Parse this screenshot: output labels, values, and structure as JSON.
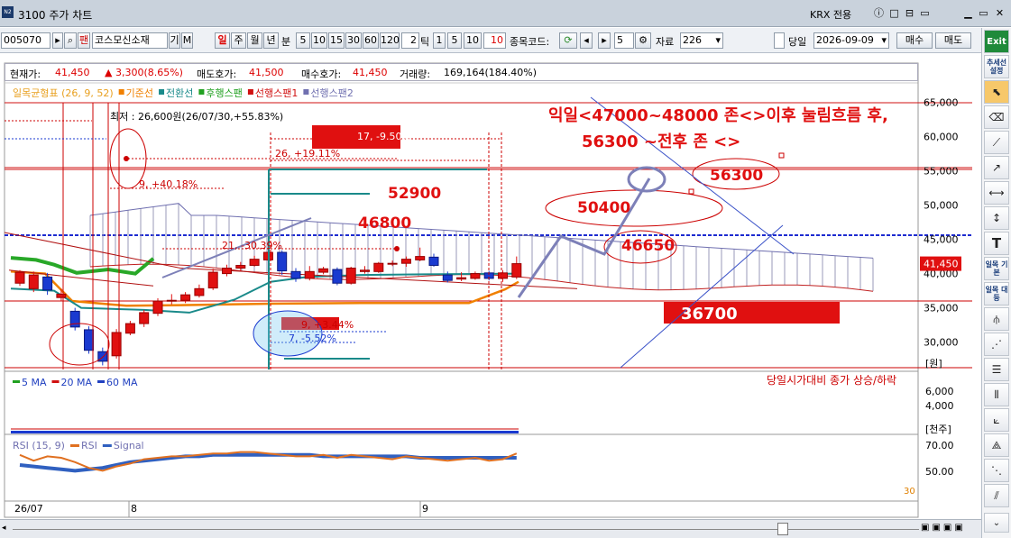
{
  "window": {
    "code_badge": "N2",
    "title": "3100 주가 차트",
    "exchange": "KRX 전용",
    "buttons": [
      "ⓘ",
      "□",
      "⊟",
      "▭",
      "⊠",
      "▭",
      "✕"
    ]
  },
  "toolbar": {
    "stock_code": "005070",
    "stock_name": "코스모신소재",
    "btn_gi": "기",
    "btn_m": "M",
    "period_tabs": [
      "일",
      "주",
      "월",
      "년"
    ],
    "minute_label": "분",
    "minute_options": [
      "5",
      "10",
      "15",
      "30",
      "60",
      "120"
    ],
    "tick_value": "2",
    "tick_label": "틱",
    "tick_options": [
      "1",
      "5",
      "10"
    ],
    "tick_selected": "10",
    "code_compare_label": "종목코드:",
    "step_value": "5",
    "data_label": "자료",
    "data_count": "226",
    "sameday_label": "당일",
    "date": "2026-09-09",
    "buy_label": "매수",
    "sell_label": "매도"
  },
  "info": {
    "price_label": "현재가:",
    "price": "41,450",
    "change": "▲ 3,300(8.65%)",
    "ask_label": "매도호가:",
    "ask": "41,500",
    "bid_label": "매수호가:",
    "bid": "41,450",
    "volume_label": "거래량:",
    "volume": "169,164(184.40%)"
  },
  "legend_ichimoku": [
    {
      "text": "일목균형표 (26, 9, 52)",
      "color": "#e8a020"
    },
    {
      "text": "기준선",
      "color": "#f08000"
    },
    {
      "text": "전환선",
      "color": "#1a8a8a"
    },
    {
      "text": "후행스팬",
      "color": "#20a020"
    },
    {
      "text": "선행스팬1",
      "color": "#d01010"
    },
    {
      "text": "선행스팬2",
      "color": "#7070b0"
    }
  ],
  "legend_ma": [
    {
      "text": "5 MA",
      "color": "#20a020"
    },
    {
      "text": "20 MA",
      "color": "#d01010"
    },
    {
      "text": "60 MA",
      "color": "#2040c0"
    }
  ],
  "legend_rsi": [
    {
      "text": "RSI (15, 9)",
      "color": "#e07020"
    },
    {
      "text": "RSI",
      "color": "#e07020"
    },
    {
      "text": "Signal",
      "color": "#3060c0"
    }
  ],
  "price_axis": [
    "65,000",
    "60,000",
    "55,000",
    "50,000",
    "45,000",
    "40,000",
    "35,000",
    "30,000"
  ],
  "price_unit": "[원]",
  "volume_axis": [
    "6,000",
    "4,000"
  ],
  "volume_unit": "[천주]",
  "rsi_axis": [
    "70.00",
    "50.00"
  ],
  "rsi_marker": "30",
  "current_price_tag": "41,450",
  "date_axis": [
    "26/07",
    "8",
    "9"
  ],
  "min_label": "최저 : 26,600원(26/07/30,+55.83%)",
  "volume_note": "당일시가대비 종가 상승/하락",
  "annotations": {
    "headline_1": "익일<47000~48000 존<>이후 눌림흐름 후,",
    "headline_2": "56300 ~전후 존 <>",
    "level_56300": "56300",
    "level_52900": "52900",
    "level_50400": "50400",
    "level_46800": "46800",
    "level_46650": "46650",
    "level_36700": "36700",
    "measure_17": "17, -9.50%",
    "measure_26": "26, +19.11%",
    "measure_9a": "9, +40.18%",
    "measure_21": "21, -30.39%",
    "measure_9b": "9, +3.44%",
    "measure_7": "7, -5.52%"
  },
  "sidebar": {
    "exit_label": "Exit",
    "trend_label": "추세선 설정",
    "ichimoku_basic": "일목 기본",
    "ichimoku_corr": "일목 대등"
  },
  "chart_data": {
    "type": "candlestick",
    "title": "",
    "price_range": [
      26000,
      66000
    ],
    "candles": [
      {
        "o": 38600,
        "c": 40200,
        "h": 40500,
        "l": 38200
      },
      {
        "o": 37800,
        "c": 39800,
        "h": 40300,
        "l": 37300
      },
      {
        "o": 39500,
        "c": 37600,
        "h": 40100,
        "l": 36900
      },
      {
        "o": 36500,
        "c": 37000,
        "h": 37800,
        "l": 36000
      },
      {
        "o": 34500,
        "c": 32200,
        "h": 35000,
        "l": 31700
      },
      {
        "o": 31800,
        "c": 28800,
        "h": 32300,
        "l": 28300
      },
      {
        "o": 28600,
        "c": 27200,
        "h": 29200,
        "l": 26600
      },
      {
        "o": 28000,
        "c": 31400,
        "h": 31900,
        "l": 27600
      },
      {
        "o": 31300,
        "c": 32700,
        "h": 33100,
        "l": 31000
      },
      {
        "o": 32700,
        "c": 34300,
        "h": 34700,
        "l": 32200
      },
      {
        "o": 34200,
        "c": 36000,
        "h": 36400,
        "l": 33800
      },
      {
        "o": 36000,
        "c": 36100,
        "h": 37000,
        "l": 35500
      },
      {
        "o": 36100,
        "c": 36900,
        "h": 37300,
        "l": 35700
      },
      {
        "o": 36800,
        "c": 37800,
        "h": 38400,
        "l": 36500
      },
      {
        "o": 37900,
        "c": 40200,
        "h": 40700,
        "l": 37600
      },
      {
        "o": 40000,
        "c": 40800,
        "h": 41300,
        "l": 39600
      },
      {
        "o": 40800,
        "c": 41200,
        "h": 41700,
        "l": 40400
      },
      {
        "o": 41200,
        "c": 42100,
        "h": 42600,
        "l": 41000
      },
      {
        "o": 42000,
        "c": 43100,
        "h": 44800,
        "l": 41800
      },
      {
        "o": 43100,
        "c": 40400,
        "h": 43400,
        "l": 39800
      },
      {
        "o": 40300,
        "c": 39300,
        "h": 40800,
        "l": 38800
      },
      {
        "o": 39300,
        "c": 40300,
        "h": 41100,
        "l": 39000
      },
      {
        "o": 40200,
        "c": 40700,
        "h": 41000,
        "l": 39900
      },
      {
        "o": 40600,
        "c": 38600,
        "h": 40900,
        "l": 38300
      },
      {
        "o": 38600,
        "c": 40800,
        "h": 41000,
        "l": 38400
      },
      {
        "o": 40300,
        "c": 40500,
        "h": 41100,
        "l": 40000
      },
      {
        "o": 40300,
        "c": 41500,
        "h": 41700,
        "l": 40100
      },
      {
        "o": 41400,
        "c": 41500,
        "h": 41900,
        "l": 41100
      },
      {
        "o": 41500,
        "c": 42100,
        "h": 42500,
        "l": 41000
      },
      {
        "o": 42000,
        "c": 42500,
        "h": 43800,
        "l": 41800
      },
      {
        "o": 42400,
        "c": 41200,
        "h": 42900,
        "l": 41000
      },
      {
        "o": 39800,
        "c": 39000,
        "h": 40300,
        "l": 38700
      },
      {
        "o": 39200,
        "c": 39400,
        "h": 40200,
        "l": 38900
      },
      {
        "o": 39300,
        "c": 40000,
        "h": 40300,
        "l": 39100
      },
      {
        "o": 40100,
        "c": 39300,
        "h": 40400,
        "l": 39000
      },
      {
        "o": 39300,
        "c": 40100,
        "h": 40500,
        "l": 38800
      },
      {
        "o": 39500,
        "c": 41450,
        "h": 42500,
        "l": 39200
      }
    ]
  }
}
